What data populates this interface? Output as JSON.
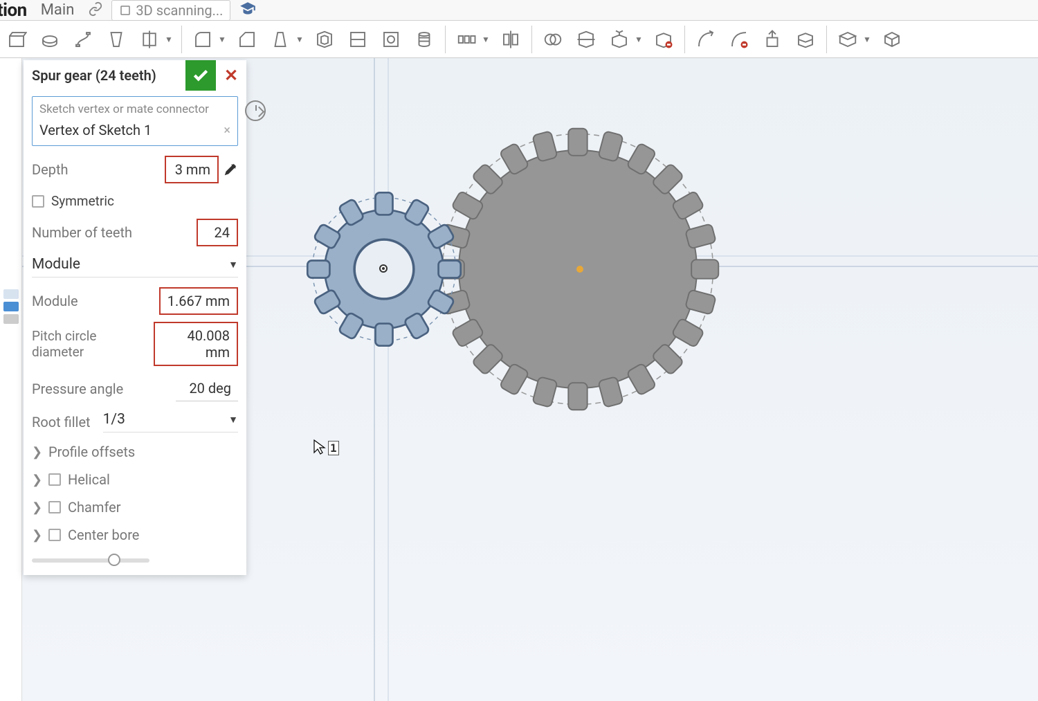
{
  "header": {
    "title_fragment": "ntation",
    "main_tab": "Main",
    "secondary_tab": "3D scanning..."
  },
  "panel": {
    "title": "Spur gear (24 teeth)",
    "selector": {
      "label": "Sketch vertex or mate connector",
      "value": "Vertex of Sketch 1"
    },
    "depth": {
      "label": "Depth",
      "value": "3 mm"
    },
    "symmetric": {
      "label": "Symmetric",
      "checked": false
    },
    "num_teeth": {
      "label": "Number of teeth",
      "value": "24"
    },
    "gear_input_type": "Module",
    "module": {
      "label": "Module",
      "value": "1.667 mm"
    },
    "pitch_dia": {
      "label": "Pitch circle diameter",
      "value": "40.008 mm"
    },
    "pressure_angle": {
      "label": "Pressure angle",
      "value": "20 deg"
    },
    "root_fillet": {
      "label": "Root fillet",
      "value": "1/3"
    },
    "profile_offsets": "Profile offsets",
    "helical": "Helical",
    "chamfer": "Chamfer",
    "center_bore": "Center bore"
  },
  "cursor": {
    "label": "1"
  }
}
